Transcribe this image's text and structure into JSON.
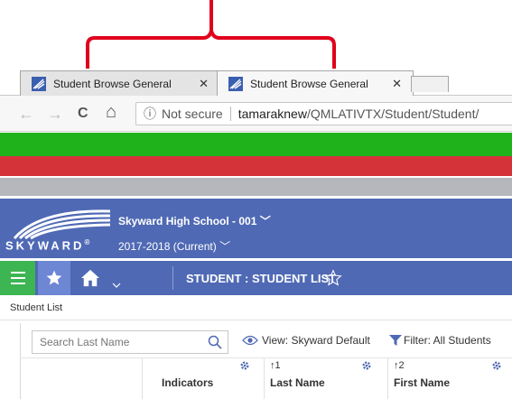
{
  "browser": {
    "tabs": [
      {
        "title": "Student Browse General",
        "close": "✕"
      },
      {
        "title": "Student Browse General",
        "close": "✕"
      }
    ],
    "address": {
      "info_glyph": "ⓘ",
      "security_text": "Not secure",
      "host": "tamaraknew",
      "path": "/QMLATIVTX/Student/Student/"
    },
    "nav_glyphs": {
      "back": "←",
      "forward": "→",
      "reload": "C",
      "home": "⌂"
    }
  },
  "stripe_colors": {
    "green": "#1fb21a",
    "red": "#d4333a",
    "gray": "#b5b7bc"
  },
  "header": {
    "logo_word": "SKYWARD",
    "logo_mark": "®",
    "school": "Skyward High School - 001",
    "year": "2017-2018 (Current)",
    "caret": "﹀",
    "accent": "#4f69b4"
  },
  "nav": {
    "page_title": "STUDENT : STUDENT LIST"
  },
  "breadcrumb": "Student List",
  "toolbar": {
    "search_placeholder": "Search Last Name",
    "view_label": "View: Skyward Default",
    "filter_label": "Filter: All Students"
  },
  "columns": [
    {
      "label": "Indicators",
      "sort": ""
    },
    {
      "label": "Last Name",
      "sort": "↑1"
    },
    {
      "label": "First Name",
      "sort": "↑2"
    }
  ]
}
